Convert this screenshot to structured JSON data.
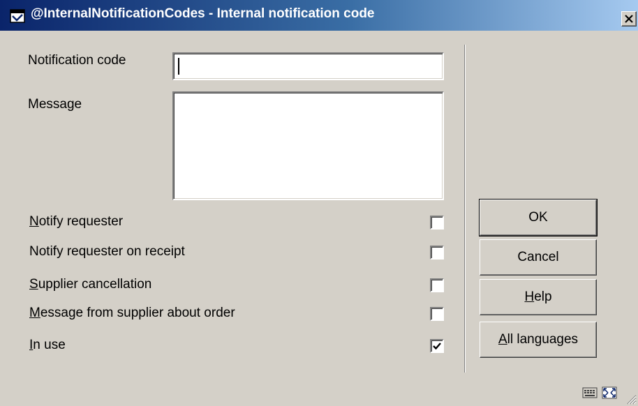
{
  "window": {
    "title": "@InternalNotificationCodes - Internal notification code",
    "close_label": "×"
  },
  "form": {
    "notification_code": {
      "label": "Notification code",
      "value": ""
    },
    "message": {
      "label": "Message",
      "value": ""
    }
  },
  "options": [
    {
      "key": "N",
      "rest": "otify requester",
      "checked": false
    },
    {
      "key": "",
      "rest": "Notify requester on receipt",
      "checked": false
    },
    {
      "key": "S",
      "rest": "upplier cancellation",
      "checked": false
    },
    {
      "key": "M",
      "rest": "essage from supplier about order",
      "checked": false
    },
    {
      "key": "I",
      "rest": "n use",
      "checked": true
    }
  ],
  "buttons": {
    "ok": {
      "key": "",
      "rest": "OK"
    },
    "cancel": {
      "key": "",
      "rest": "Cancel"
    },
    "help": {
      "key": "H",
      "rest": "elp"
    },
    "all_languages": {
      "key": "A",
      "rest": "ll languages"
    }
  },
  "icons": {
    "app": "window-icon",
    "status": [
      "keyboard-icon",
      "resize-arrows-icon",
      "size-grip-icon"
    ]
  },
  "colors": {
    "title_start": "#0A246A",
    "title_end": "#A6CAF0",
    "face": "#D4D0C8"
  }
}
